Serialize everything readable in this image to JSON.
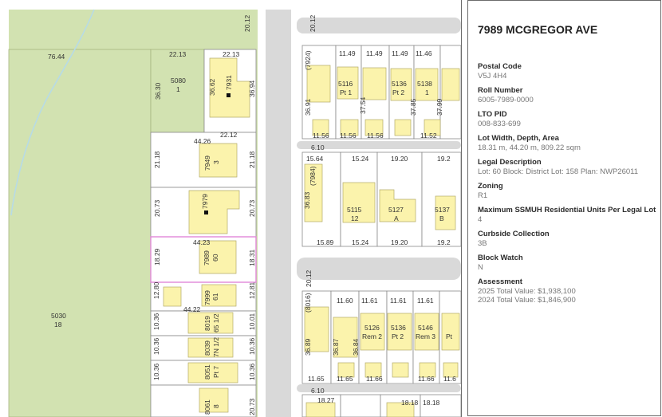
{
  "property": {
    "title": "7989 MCGREGOR AVE",
    "fields": [
      {
        "label": "Postal Code",
        "value": "V5J 4H4"
      },
      {
        "label": "Roll Number",
        "value": "6005-7989-0000"
      },
      {
        "label": "LTO PID",
        "value": "008-833-699"
      },
      {
        "label": "Lot Width, Depth, Area",
        "value": "18.31 m, 44.20 m, 809.22 sqm"
      },
      {
        "label": "Legal Description",
        "value": "Lot: 60 Block:  District Lot: 158 Plan: NWP26011"
      },
      {
        "label": "Zoning",
        "value": "R1"
      },
      {
        "label": "Maximum SSMUH Residential Units Per Legal Lot",
        "value": "4"
      },
      {
        "label": "Curbside Collection",
        "value": "3B"
      },
      {
        "label": "Block Watch",
        "value": "N"
      },
      {
        "label": "Assessment",
        "value": "2025 Total Value: $1,938,100",
        "value2": "2024 Total Value: $1,846,900"
      }
    ]
  },
  "map": {
    "colors": {
      "park": "#d2e2b1",
      "park_border": "#b5c48f",
      "road": "#d9d9d9",
      "building": "#fbf3ac",
      "building_border": "#b3aa6a",
      "selected_outline": "#e087d8",
      "lot_line": "#8a8a8a"
    },
    "labels": {
      "road_top": "20.12",
      "park_big_area": "76.44",
      "park_big_id": "5030",
      "park_big_num": "18",
      "park_small_w": "22.13",
      "park_small_d": "36.30",
      "park_small_id": "5080",
      "park_small_num": "1",
      "lot_7931_w_top": "22.13",
      "lot_7931_d_left": "36.62",
      "lot_7931_d_right": "36.94",
      "lot_7931_w_bottom": "22.12",
      "lot_7931_addr": "7931",
      "lot_7949_w": "44.26",
      "lot_7949_d_left": "21.18",
      "lot_7949_d_right": "21.18",
      "lot_7949_addr": "7949",
      "lot_7949_num": "3",
      "lot_7979_d_left": "20.73",
      "lot_7979_d_right": "20.73",
      "lot_7979_addr": "7979",
      "sel_w": "44.23",
      "sel_d_left": "18.29",
      "sel_d_right": "18.31",
      "sel_addr": "7989",
      "sel_num": "60",
      "lot_7999_d_left": "12.80",
      "lot_7999_d_right": "12.81",
      "lot_7999_addr": "7999",
      "lot_7999_num": "61",
      "lot_8019_w": "44.22",
      "lot_8019_d_left": "10.36",
      "lot_8019_d_right": "10.01",
      "lot_8019_addr": "8019",
      "lot_8019_num": "65 1/2",
      "lot_8039_d_left": "10.36",
      "lot_8039_d_right": "10.36",
      "lot_8039_addr": "8039",
      "lot_8039_num": "7N 1/2",
      "lot_8051_d_left": "10.36",
      "lot_8051_d_right": "10.36",
      "lot_8051_addr": "8051",
      "lot_8051_num": "Pt 7",
      "lot_8061_d_right": "20.73",
      "lot_8061_addr": "8061",
      "lot_8061_num": "8",
      "road_mid": "20.12",
      "e_r1_left_addr": "(7924)",
      "e_r1_left_d": "36.91",
      "e_r1_w1": "11.49",
      "e_r1_w2": "11.49",
      "e_r1_w3": "11.49",
      "e_r1_w4": "11.46",
      "e_r1_b1": "11.56",
      "e_r1_b2": "11.56",
      "e_r1_b3": "11.56",
      "e_r1_b4": "11.52",
      "e_5116": "5116",
      "e_5116_n": "Pt 1",
      "e_5136": "5136",
      "e_5136_n": "Pt 2",
      "e_5138": "5138",
      "e_5138_n": "1",
      "e_r1_d2": "37.54",
      "e_r1_d3": "37.85",
      "e_r1_d4": "37.99",
      "road_e1": "6.10",
      "e_r2_w1": "15.64",
      "e_r2_w2": "15.24",
      "e_r2_w3": "19.20",
      "e_r2_w4": "19.2",
      "e_r2_left_addr": "(7984)",
      "e_r2_d": "36.83",
      "e_5115": "5115",
      "e_5115_n": "12",
      "e_5127": "5127",
      "e_5127_n": "A",
      "e_5137": "5137",
      "e_5137_n": "B",
      "e_r2_b1": "15.89",
      "e_r2_b2": "15.24",
      "e_r2_b3": "19.20",
      "e_r2_b4": "19.2",
      "e_r3_left_addr": "(8016)",
      "e_r3_d": "36.89",
      "e_r3_d2": "36.87",
      "e_r3_d3": "36.84",
      "e_r3_w1": "11.60",
      "e_r3_w2": "11.61",
      "e_r3_w3": "11.61",
      "e_r3_w4": "11.61",
      "e_5126": "5126",
      "e_5126_n": "Rem 2",
      "e_5136b": "5136",
      "e_5136b_n": "Pt 2",
      "e_5146": "5146",
      "e_5146_n": "Rem 3",
      "e_5156_n": "Pt",
      "e_r3_b1": "11.65",
      "e_r3_b2": "11.65",
      "e_r3_b3": "11.66",
      "e_r3_b4": "11.66",
      "e_r3_b5": "11.6",
      "road_e2": "6.10",
      "e_r4_w1": "18.27",
      "e_r4_w2": "18.18",
      "e_r4_w3": "18.18"
    }
  }
}
